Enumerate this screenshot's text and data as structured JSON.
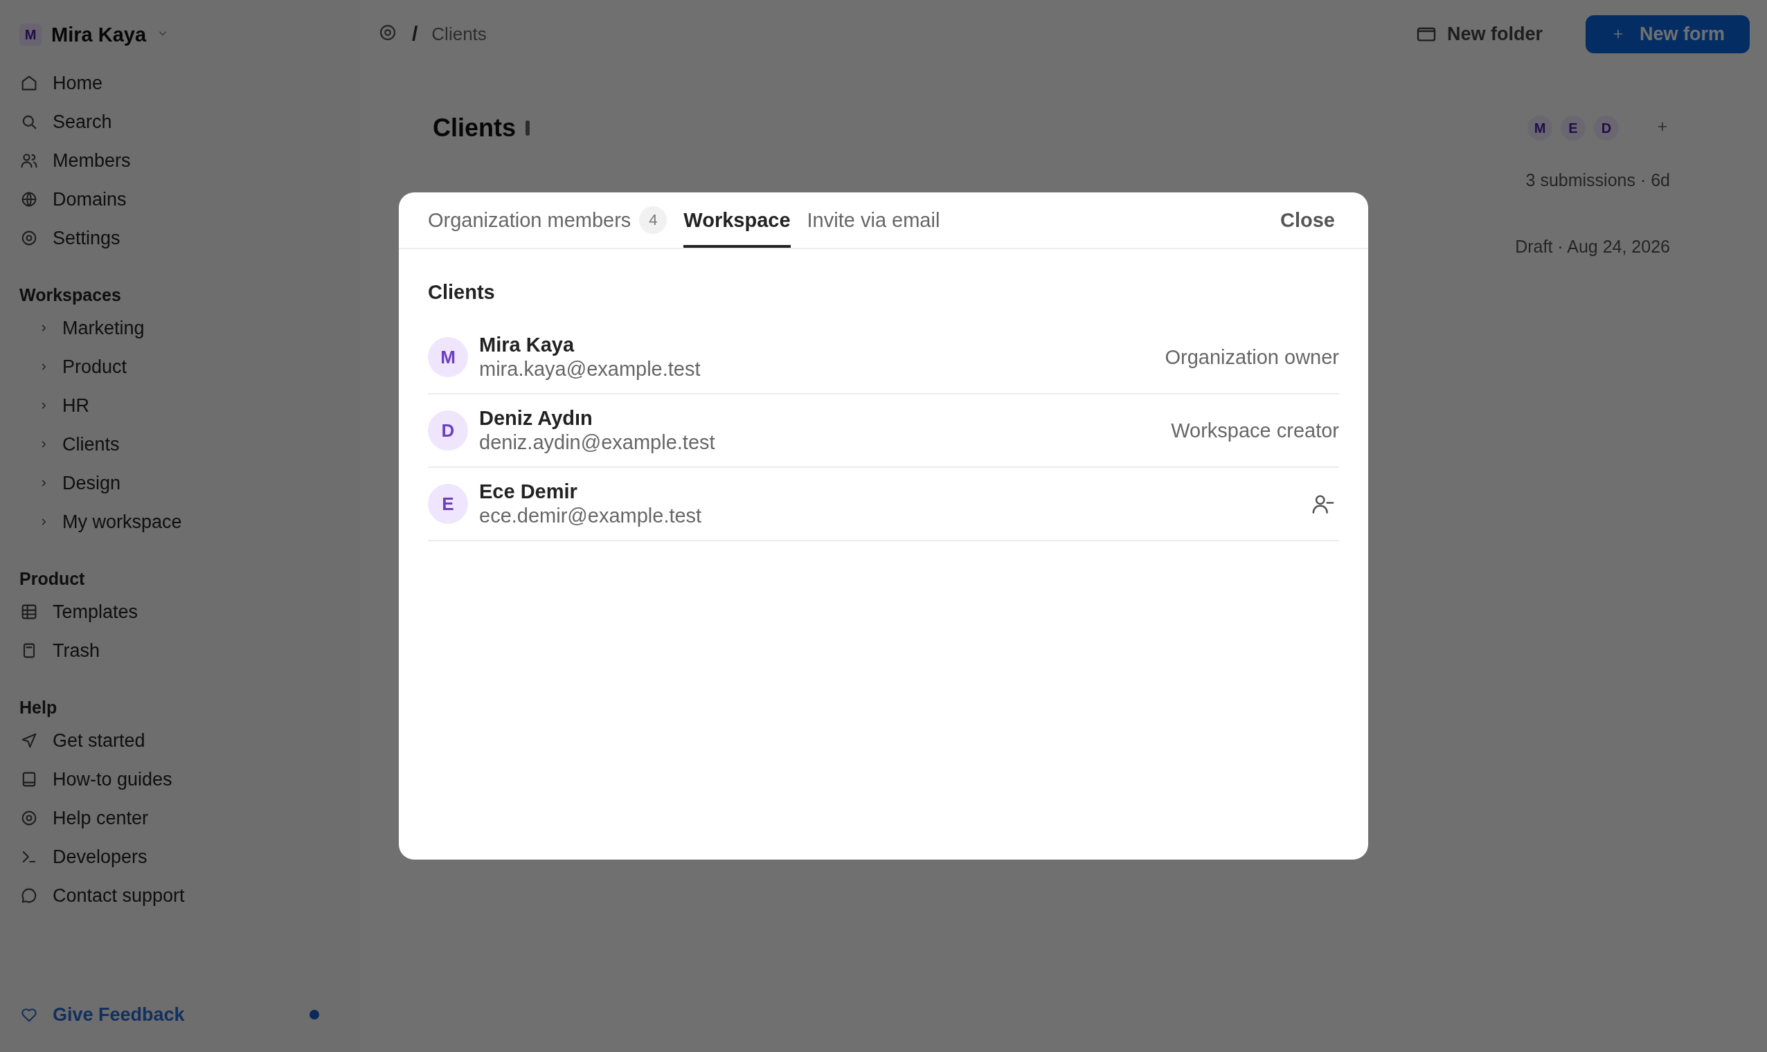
{
  "sidebar": {
    "account": {
      "initial": "M",
      "name": "Mira Kaya"
    },
    "nav": [
      {
        "label": "Home"
      },
      {
        "label": "Search"
      },
      {
        "label": "Members"
      },
      {
        "label": "Domains"
      },
      {
        "label": "Settings"
      }
    ],
    "sections": [
      {
        "title": "Workspaces",
        "kind": "tree",
        "items": [
          {
            "label": "Marketing"
          },
          {
            "label": "Product"
          },
          {
            "label": "HR"
          },
          {
            "label": "Clients"
          },
          {
            "label": "Design"
          },
          {
            "label": "My workspace"
          }
        ]
      },
      {
        "title": "Product",
        "kind": "nav",
        "items": [
          {
            "label": "Templates"
          },
          {
            "label": "Trash"
          }
        ]
      },
      {
        "title": "Help",
        "kind": "nav",
        "items": [
          {
            "label": "Get started"
          },
          {
            "label": "How-to guides"
          },
          {
            "label": "Help center"
          },
          {
            "label": "Developers"
          },
          {
            "label": "Contact support"
          }
        ]
      }
    ],
    "feedback": {
      "label": "Give Feedback",
      "unread": true
    }
  },
  "breadcrumb": {
    "separator": "/",
    "current": "Clients"
  },
  "toolbar": {
    "secondary": "New folder",
    "primary": "New form"
  },
  "page": {
    "title": "Clients",
    "member_initials": [
      "M",
      "E",
      "D"
    ],
    "form_meta": [
      "3 submissions · 6d",
      "Draft · Aug 24, 2026"
    ]
  },
  "dialog": {
    "tabs": [
      {
        "label": "Organization members",
        "count": "4",
        "selected": false
      },
      {
        "label": "Workspace",
        "selected": true
      },
      {
        "label": "Invite via email",
        "selected": false
      }
    ],
    "close": "Close",
    "workspace": "Clients",
    "members": [
      {
        "initial": "M",
        "name": "Mira Kaya",
        "email": "mira.kaya@example.test",
        "kind": "role",
        "role": "Organization owner"
      },
      {
        "initial": "D",
        "name": "Deniz Aydın",
        "email": "deniz.aydin@example.test",
        "kind": "role",
        "role": "Workspace creator"
      },
      {
        "initial": "E",
        "name": "Ece Demir",
        "email": "ece.demir@example.test",
        "kind": "remove"
      }
    ]
  }
}
